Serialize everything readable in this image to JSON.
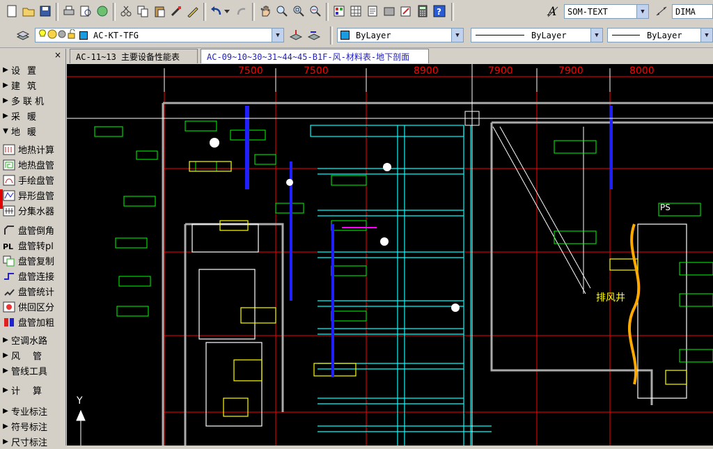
{
  "toolbar_top": {
    "text_style": "SOM-TEXT",
    "dim_style": "DIMA"
  },
  "toolbar_layer": {
    "layer_name": "AC-KT-TFG",
    "color": "ByLayer",
    "linetype": "ByLayer",
    "lineweight": "ByLayer"
  },
  "panel": {
    "close": "×",
    "categories": [
      {
        "label": "设置"
      },
      {
        "label": "建筑"
      },
      {
        "label": "多联机"
      },
      {
        "label": "采暖"
      },
      {
        "label": "地暖"
      }
    ],
    "sub_items": [
      {
        "label": "地热计算",
        "icon": "floor-heat-calc-icon"
      },
      {
        "label": "地热盘管",
        "icon": "floor-coil-icon"
      },
      {
        "label": "手绘盘管",
        "icon": "hand-draw-coil-icon"
      },
      {
        "label": "异形盘管",
        "icon": "irregular-coil-icon"
      },
      {
        "label": "分集水器",
        "icon": "manifold-icon"
      },
      {
        "label": "盘管倒角",
        "icon": "coil-chamfer-icon"
      },
      {
        "label": "盘管转pl",
        "icon": "coil-to-pl-icon"
      },
      {
        "label": "盘管复制",
        "icon": "coil-copy-icon"
      },
      {
        "label": "盘管连接",
        "icon": "coil-connect-icon"
      },
      {
        "label": "盘管统计",
        "icon": "coil-stats-icon"
      },
      {
        "label": "供回区分",
        "icon": "supply-return-icon"
      },
      {
        "label": "盘管加粗",
        "icon": "coil-thicken-icon"
      }
    ],
    "more_categories": [
      {
        "label": "空调水路"
      },
      {
        "label": "风管"
      },
      {
        "label": "管线工具"
      },
      {
        "label": "计算"
      },
      {
        "label": "专业标注"
      },
      {
        "label": "符号标注"
      },
      {
        "label": "尺寸标注"
      }
    ]
  },
  "tabs": [
    {
      "label": "AC-11~13 主要设备性能表"
    },
    {
      "label": "AC-09~10~30~31~44~45-B1F-风-材料表-地下剖面"
    }
  ],
  "drawing": {
    "dims": [
      "7500",
      "7500",
      "8900",
      "7900",
      "7900",
      "8000"
    ],
    "label_shaft": "排风井",
    "label_ps": "PS",
    "ucs_y": "Y"
  },
  "colors": {
    "canvas_bg": "#000000",
    "cyan": "#00ffff",
    "green": "#00ff00",
    "yellow": "#ffff00",
    "red": "#ff0000",
    "blue": "#2020ff",
    "white": "#ffffff",
    "magenta": "#ff00ff"
  }
}
